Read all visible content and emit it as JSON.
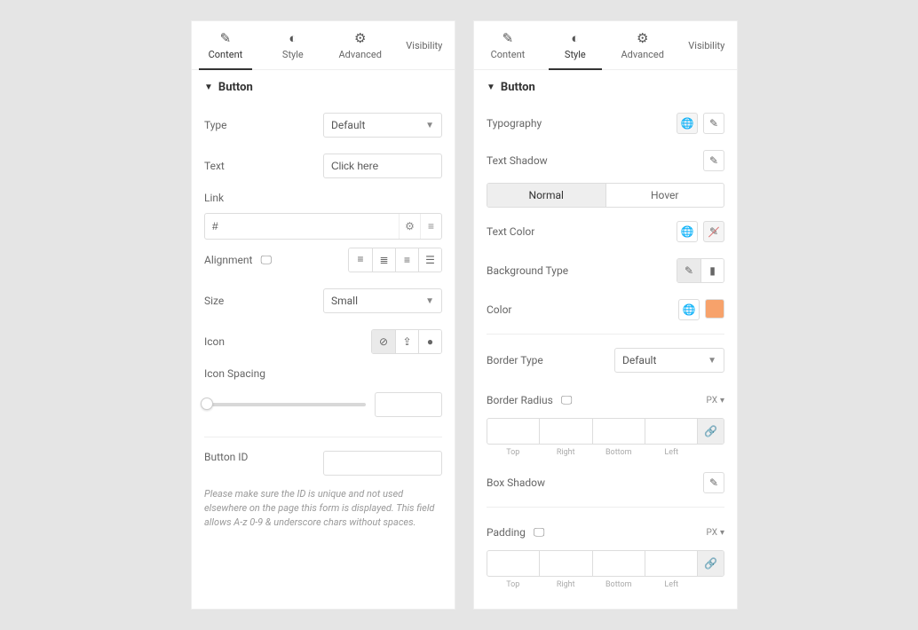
{
  "tabs": {
    "content": "Content",
    "style": "Style",
    "advanced": "Advanced",
    "visibility": "Visibility"
  },
  "section_title": "Button",
  "content_panel": {
    "type_label": "Type",
    "type_value": "Default",
    "text_label": "Text",
    "text_value": "Click here",
    "link_label": "Link",
    "link_value": "#",
    "alignment_label": "Alignment",
    "size_label": "Size",
    "size_value": "Small",
    "icon_label": "Icon",
    "icon_spacing_label": "Icon Spacing",
    "button_id_label": "Button ID",
    "button_id_note": "Please make sure the ID is unique and not used elsewhere on the page this form is displayed. This field allows A-z 0-9 & underscore chars without spaces."
  },
  "style_panel": {
    "typography_label": "Typography",
    "text_shadow_label": "Text Shadow",
    "state_normal": "Normal",
    "state_hover": "Hover",
    "text_color_label": "Text Color",
    "bg_type_label": "Background Type",
    "color_label": "Color",
    "border_type_label": "Border Type",
    "border_type_value": "Default",
    "border_radius_label": "Border Radius",
    "unit": "PX",
    "box_shadow_label": "Box Shadow",
    "padding_label": "Padding",
    "dim_top": "Top",
    "dim_right": "Right",
    "dim_bottom": "Bottom",
    "dim_left": "Left"
  }
}
